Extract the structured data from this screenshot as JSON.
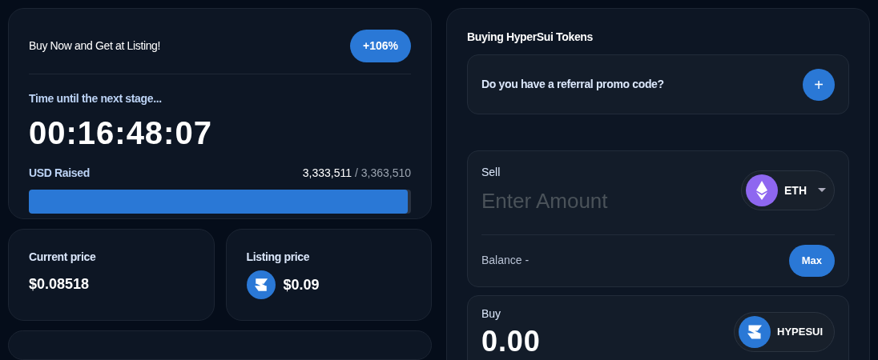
{
  "promo": {
    "text": "Buy Now and Get at Listing!",
    "badge": "+106%"
  },
  "timer": {
    "label": "Time until the next stage...",
    "value": "00:16:48:07"
  },
  "raised": {
    "label": "USD Raised",
    "amount": "3,333,511",
    "goal": "/ 3,363,510",
    "level": 0.991
  },
  "prices": [
    {
      "label": "Current price",
      "value": "$0.08518",
      "kind": "plain"
    },
    {
      "label": "Listing price",
      "value": "$0.09",
      "kind": "token"
    }
  ],
  "buy_panel": {
    "title": "Buying HyperSui Tokens",
    "referral": {
      "text": "Do you have a referral promo code?",
      "button": "+"
    },
    "sell": {
      "label": "Sell",
      "placeholder": "Enter Amount",
      "token": "ETH",
      "balance_label": "Balance -",
      "max_button": "Max"
    },
    "buy": {
      "label": "Buy",
      "value": "0.00",
      "token": "HYPESUI"
    }
  }
}
